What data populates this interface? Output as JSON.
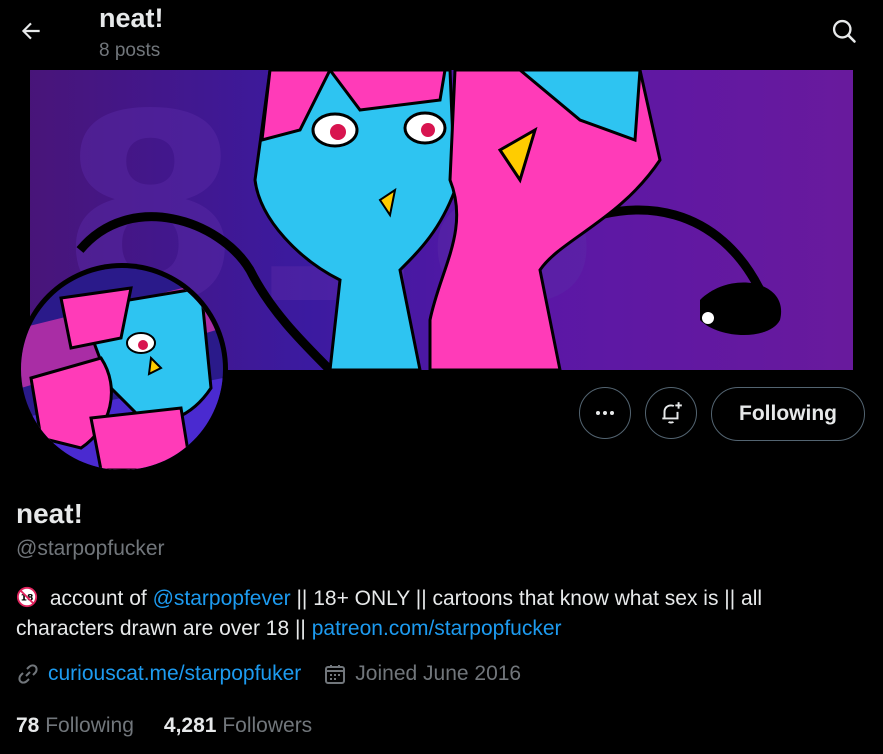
{
  "header": {
    "title": "neat!",
    "posts": "8 posts",
    "back_icon": "arrow-left-icon",
    "search_icon": "search-icon"
  },
  "profile": {
    "name": "neat!",
    "handle": "@starpopfucker",
    "follow_state": "Following",
    "bio": {
      "age_badge": "18",
      "text1": " account of ",
      "mention": "@starpopfever",
      "text2": " || 18+ ONLY || cartoons that know what sex is || all characters drawn are over 18 || ",
      "patreon_link": "patreon.com/starpopfucker"
    },
    "website": "curiouscat.me/starpopfuker",
    "joined": "Joined June 2016",
    "following_count": "78",
    "following_label": "Following",
    "followers_count": "4,281",
    "followers_label": "Followers"
  },
  "colors": {
    "background": "#000000",
    "text": "#e7e9ea",
    "muted": "#71767b",
    "link": "#1d9bf0",
    "border": "#536471"
  }
}
